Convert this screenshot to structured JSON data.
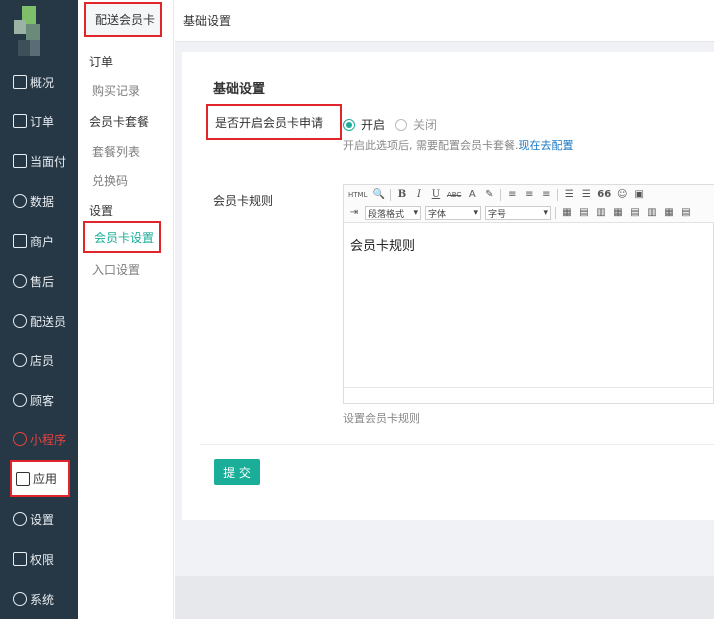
{
  "nav": {
    "items": [
      {
        "label": "概况",
        "icon": "dashboard-icon"
      },
      {
        "label": "订单",
        "icon": "order-icon"
      },
      {
        "label": "当面付",
        "icon": "pay-icon"
      },
      {
        "label": "数据",
        "icon": "data-icon"
      },
      {
        "label": "商户",
        "icon": "merchant-icon"
      },
      {
        "label": "售后",
        "icon": "aftersale-icon"
      },
      {
        "label": "配送员",
        "icon": "courier-icon"
      },
      {
        "label": "店员",
        "icon": "clerk-icon"
      },
      {
        "label": "顾客",
        "icon": "customer-icon"
      },
      {
        "label": "小程序",
        "icon": "miniprogram-icon"
      },
      {
        "label": "应用",
        "icon": "apps-icon"
      },
      {
        "label": "设置",
        "icon": "settings-icon"
      },
      {
        "label": "权限",
        "icon": "lock-icon"
      },
      {
        "label": "系统",
        "icon": "system-icon"
      }
    ]
  },
  "subnav": {
    "title": "配送会员卡",
    "group_order": "订单",
    "purchase_records": "购买记录",
    "group_package": "会员卡套餐",
    "package_list": "套餐列表",
    "redeem_code": "兑换码",
    "group_settings": "设置",
    "card_settings": "会员卡设置",
    "entry_settings": "入口设置"
  },
  "main": {
    "breadcrumb": "基础设置",
    "card_title": "基础设置",
    "apply_question": "是否开启会员卡申请",
    "radio_on": "开启",
    "radio_off": "关闭",
    "hint_prefix": "开启此选项后, 需要配置会员卡套餐.",
    "hint_link": "现在去配置",
    "rule_label": "会员卡规则",
    "editor_content": "会员卡规则",
    "rule_tip": "设置会员卡规则",
    "submit_label": "提 交"
  },
  "editor_toolbar": {
    "html": "HTML",
    "bold": "B",
    "italic": "I",
    "underline": "U",
    "strike": "ABC",
    "fontcolor": "A",
    "quote": "66",
    "paragraph": "段落格式",
    "font": "字体",
    "fontsize": "字号"
  },
  "colors": {
    "sidebar_bg": "#263746",
    "accent": "#1aad98",
    "highlight_red": "#e0262a",
    "link": "#1a78c2"
  }
}
